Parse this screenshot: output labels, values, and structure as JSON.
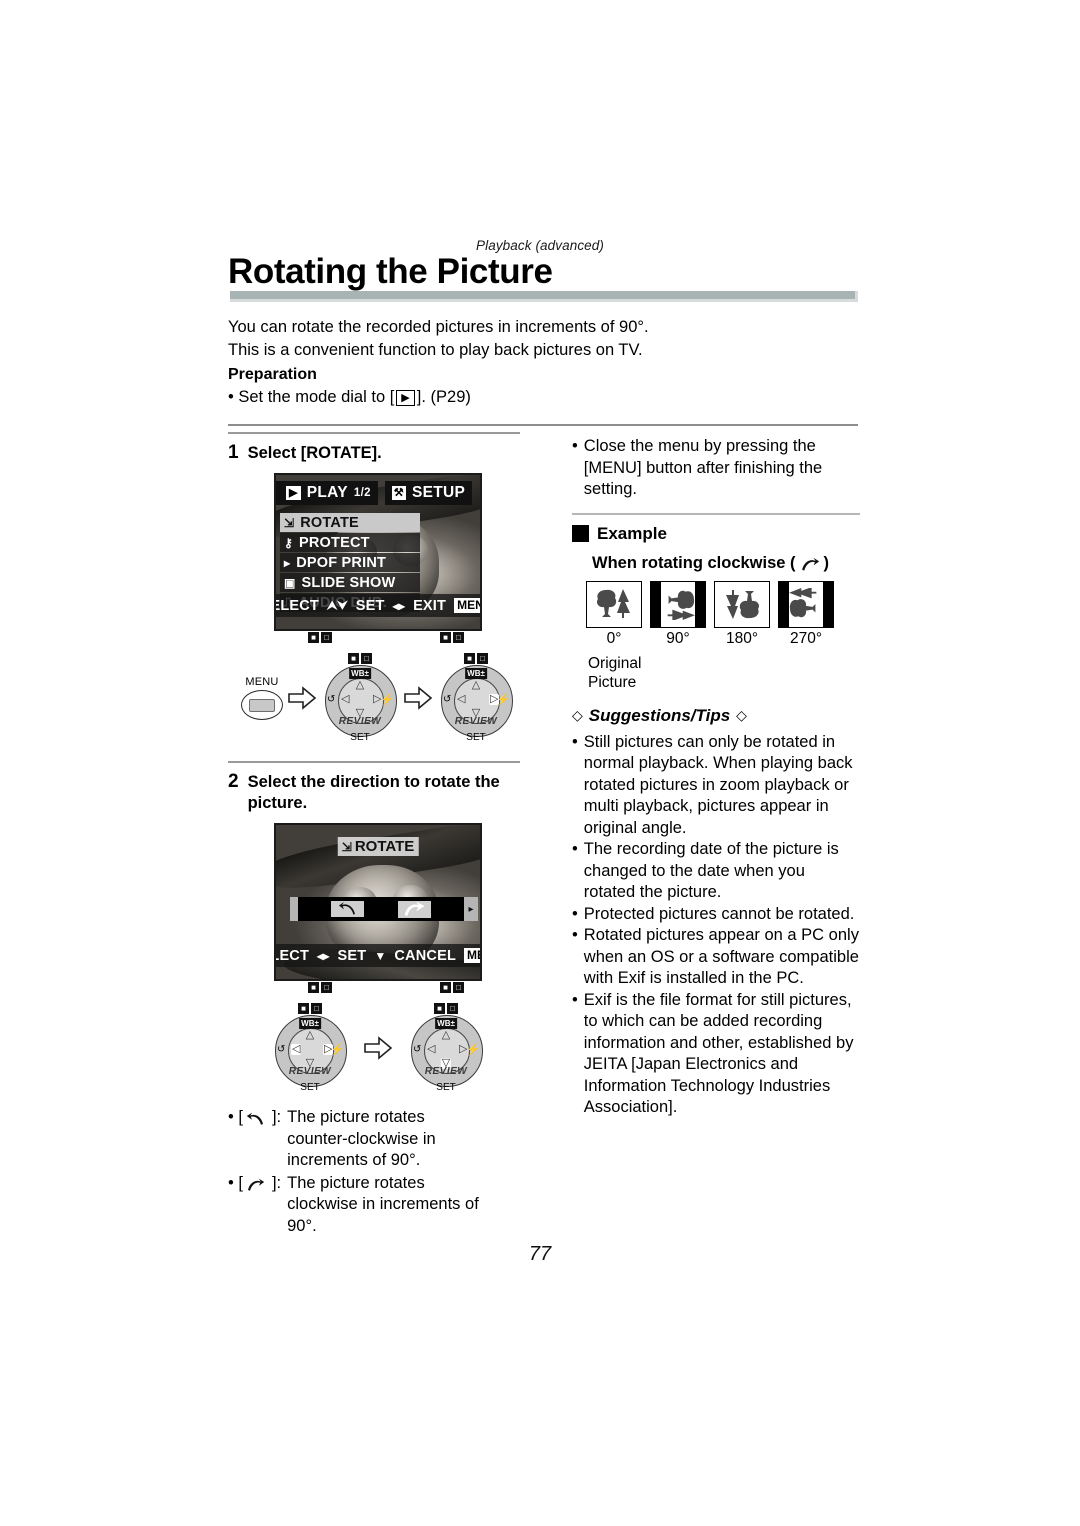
{
  "document": {
    "running_head": "Playback (advanced)",
    "title": "Rotating the Picture",
    "page_number": "77"
  },
  "intro": {
    "line1": "You can rotate the recorded pictures in increments of 90°.",
    "line2": "This is a convenient function to play back pictures on TV."
  },
  "preparation": {
    "heading": "Preparation",
    "bullet": "• Set the mode dial to [",
    "bullet_end": "]. (P29)"
  },
  "step1": {
    "number": "1",
    "title": "Select [ROTATE].",
    "lcd": {
      "tab_play": "PLAY",
      "page_indicator": "1/2",
      "tab_setup": "SETUP",
      "items": [
        {
          "icon": "rotate-icon",
          "label": "ROTATE",
          "selected": true
        },
        {
          "icon": "key-icon",
          "label": "PROTECT",
          "selected": false
        },
        {
          "icon": "dpof-icon",
          "label": "DPOF PRINT",
          "selected": false
        },
        {
          "icon": "slideshow-icon",
          "label": "SLIDE SHOW",
          "selected": false
        },
        {
          "icon": "microphone-icon",
          "label": "AUDIO DUB.",
          "selected": false
        }
      ],
      "footer_select": "SELECT",
      "footer_set": "SET",
      "footer_exit": "EXIT",
      "footer_menu_chip": "MENU"
    },
    "dial": {
      "menu_label": "MENU",
      "wb_label": "WB±",
      "review_label": "REVIEW",
      "set_label": "SET"
    }
  },
  "step2": {
    "number": "2",
    "title_line1": "Select the direction to rotate the",
    "title_line2": "picture.",
    "lcd": {
      "overlay_title": "ROTATE",
      "footer_select": "SELECT",
      "footer_set": "SET",
      "footer_cancel": "CANCEL",
      "footer_menu_chip": "MENU"
    },
    "notes": [
      {
        "icon": "rotate-ccw-icon",
        "prefix": "• [",
        "suffix": "]:",
        "text_line1": "The picture rotates",
        "text_line2": "counter-clockwise in",
        "text_line3": "increments of 90°."
      },
      {
        "icon": "rotate-cw-icon",
        "prefix": "• [",
        "suffix": "]:",
        "text_line1": "The picture rotates",
        "text_line2": "clockwise in increments of",
        "text_line3": "90°."
      }
    ]
  },
  "right_column": {
    "close_note": "Close the menu by pressing the [MENU] button after finishing the setting.",
    "example_heading": "Example",
    "example_subheading_before": "When rotating clockwise (",
    "example_subheading_after": ")",
    "thumbnails": [
      {
        "angle_label": "0°",
        "pillarboxed": false
      },
      {
        "angle_label": "90°",
        "pillarboxed": true
      },
      {
        "angle_label": "180°",
        "pillarboxed": false
      },
      {
        "angle_label": "270°",
        "pillarboxed": true
      }
    ],
    "original_line1": "Original",
    "original_line2": "Picture",
    "tips_heading": "Suggestions/Tips",
    "tips": [
      "Still pictures can only be rotated in normal playback. When playing back rotated pictures in zoom playback or multi playback, pictures appear in original angle.",
      "The recording date of the picture is changed to the date when you rotated the picture.",
      "Protected pictures cannot be rotated.",
      "Rotated pictures appear on a PC only when an OS or a software compatible with Exif is installed in the PC.",
      "Exif is the file format for still pictures, to which can be added recording information and other, established by JEITA [Japan Electronics and Information Technology Industries Association]."
    ]
  },
  "colors": {
    "title_rule": "#a8b4b4",
    "rule": "#9a9a9a",
    "lcd_border": "#1b1b1b"
  }
}
